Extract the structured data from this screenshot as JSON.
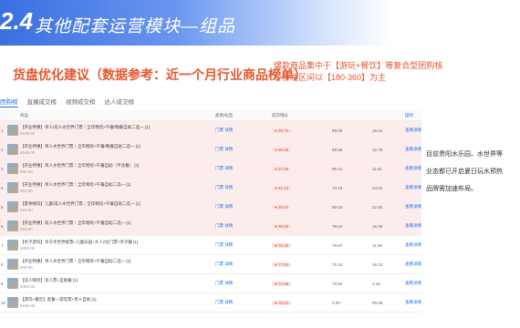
{
  "banner": {
    "number": "2.4",
    "title": "其他配套运营模块—组品"
  },
  "section_title": "货盘优化建议（数据参考：近一个月行业商品榜单）",
  "note": "爆款商品集中于【游玩+餐饮】等复合型团购核心价格区间以【180-360】为主",
  "tabs": [
    "团购榜",
    "直播成交榜",
    "视频成交榜",
    "达人成交榜"
  ],
  "table": {
    "headers": [
      "",
      "",
      "商品",
      "类目/标签",
      "成交增长",
      "",
      "",
      "操作"
    ],
    "rows": [
      {
        "rank": "1",
        "name": "【开业特惠】单人/双人水世界门票｜全年畅玩+午餐/晚餐自助二选一 [1]",
        "price": "¥189.00",
        "cat": "门票 详情",
        "rate": "● 99.75",
        "v1": "99.65",
        "v2": "16.84",
        "op": "查看详情"
      },
      {
        "rank": "2",
        "name": "【开业特惠】单人水世界门票｜全年畅玩+午餐/晚餐自助二选一 [1]",
        "price": "¥189.00",
        "cat": "门票 详情",
        "rate": "● 99.66",
        "v1": "99.56",
        "v2": "12.79",
        "op": "查看详情"
      },
      {
        "rank": "3",
        "name": "【开业特惠】单人水世界门票｜全年畅玩+午餐自助（不含餐） [1]",
        "price": "¥99.00",
        "cat": "门票 详情",
        "rate": "● 97.99",
        "v1": "95.41",
        "v2": "11.61",
        "op": "查看详情"
      },
      {
        "rank": "4",
        "name": "【开业特惠】单人水世界门票｜全年畅玩+午餐自助二选一 [1]",
        "price": "¥19.90",
        "cat": "门票 详情",
        "rate": "● 82.10",
        "v1": "73.18",
        "v2": "24.92",
        "op": "查看详情"
      },
      {
        "rank": "5",
        "name": "【夏季畅玩】儿童/成人水世界门票｜全年畅玩+午餐自助二选一 [1]",
        "price": "¥23.00",
        "cat": "门票 详情",
        "rate": "● 89.97",
        "v1": "89.53",
        "v2": "22.80",
        "op": "查看详情"
      },
      {
        "rank": "6",
        "name": "【开业特惠】双人水世界门票｜全年畅玩+午餐自助二选一 [1]",
        "price": "¥29.90",
        "cat": "门票 详情",
        "rate": "● 89.55",
        "v1": "78.54",
        "v2": "15.38",
        "op": "查看详情"
      },
      {
        "rank": "7",
        "name": "【亲子游玩】亲子水世界套票+儿童乐园+大人2位门票+亲子餐 [1]",
        "price": "¥299.00",
        "cat": "门票 详情",
        "rate": "● 78.28",
        "v1": "79.67",
        "v2": "11.68",
        "op": "查看详情"
      },
      {
        "rank": "8",
        "name": "【开业特惠】单人水世界门票｜全年畅玩+午餐自助二选一 [1]",
        "price": "¥49.00",
        "cat": "门票 详情",
        "rate": "● 77.60",
        "v1": "72.44",
        "v2": "18.34",
        "op": "查看详情"
      },
      {
        "rank": "9",
        "name": "【双人畅玩】双人票+自助餐 [1]",
        "price": "¥360.00",
        "cat": "门票 详情",
        "rate": "● 74.58",
        "v1": "73.94",
        "v2": "4.16",
        "op": "查看详情"
      },
      {
        "rank": "10",
        "name": "【游玩+餐饮】套餐—游玩票+单人自助 [1]",
        "price": "¥180.00",
        "cat": "门票 详情",
        "rate": "● 70.01",
        "v1": "0.00",
        "v2": "99.89",
        "op": "查看详情"
      }
    ]
  },
  "side_lines": [
    "目前贵阳水乐园、水世界等",
    "业态都已开启夏日玩水预热",
    "品牌需加速布局。"
  ]
}
